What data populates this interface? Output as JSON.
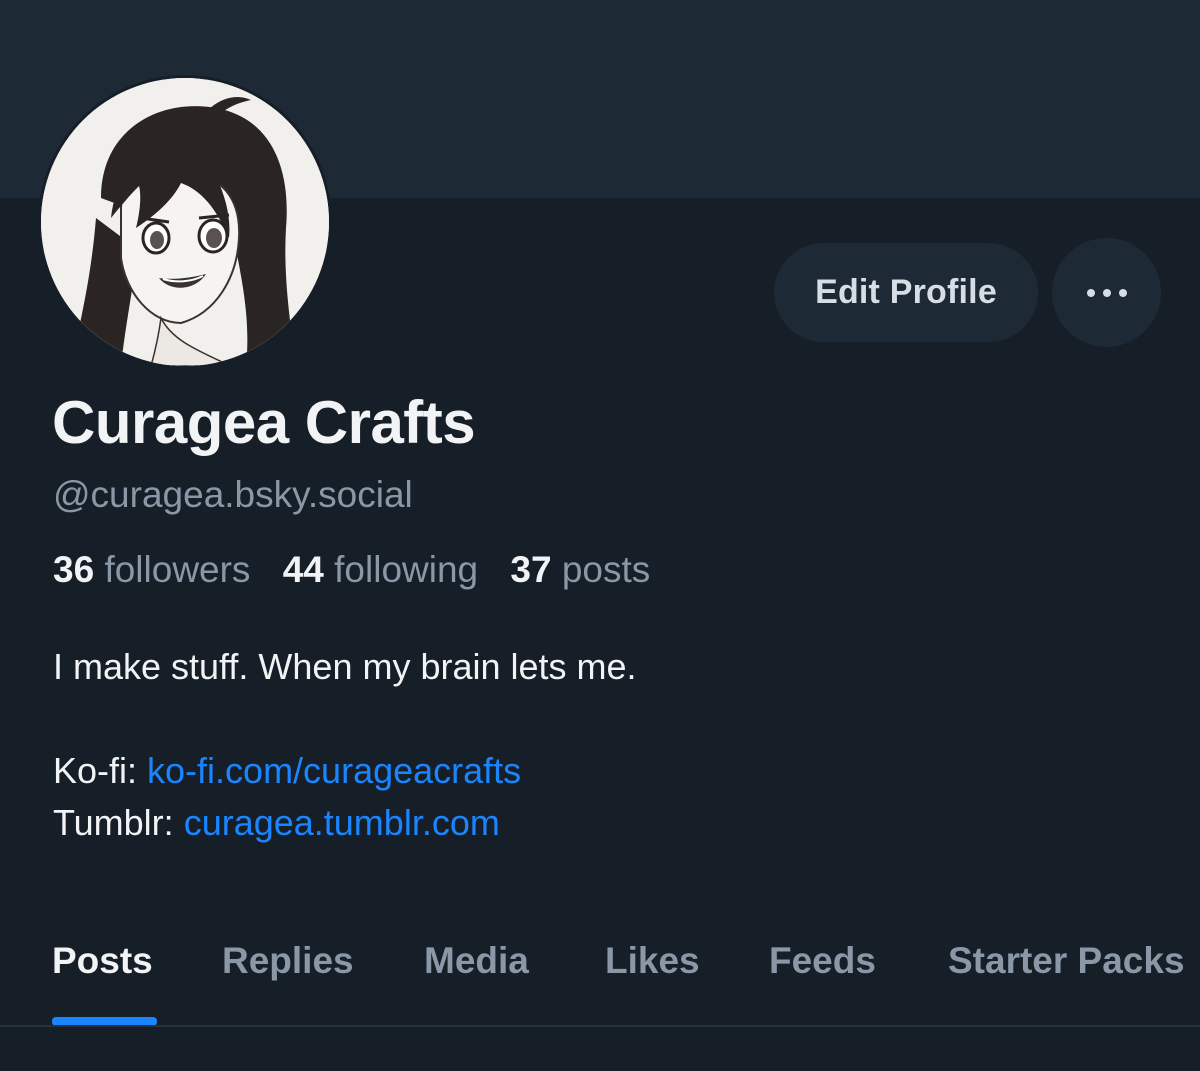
{
  "profile": {
    "display_name": "Curagea Crafts",
    "handle": "@curagea.bsky.social",
    "avatar": "anime-girl-portrait"
  },
  "actions": {
    "edit_label": "Edit Profile",
    "more_icon": "ellipsis-icon"
  },
  "stats": {
    "followers_count": "36",
    "followers_label": "followers",
    "following_count": "44",
    "following_label": "following",
    "posts_count": "37",
    "posts_label": "posts"
  },
  "bio": {
    "line1": "I make stuff. When my brain lets me.",
    "kofi_label": "Ko-fi: ",
    "kofi_link": "ko-fi.com/curageacrafts",
    "tumblr_label": "Tumblr: ",
    "tumblr_link": "curagea.tumblr.com"
  },
  "tabs": [
    {
      "label": "Posts",
      "active": true
    },
    {
      "label": "Replies",
      "active": false
    },
    {
      "label": "Media",
      "active": false
    },
    {
      "label": "Likes",
      "active": false
    },
    {
      "label": "Feeds",
      "active": false
    },
    {
      "label": "Starter Packs",
      "active": false
    }
  ],
  "colors": {
    "background": "#161e27",
    "banner": "#1e2936",
    "accent": "#1a85ff",
    "muted_text": "#8a97a6",
    "primary_text": "#f1f3f5"
  }
}
